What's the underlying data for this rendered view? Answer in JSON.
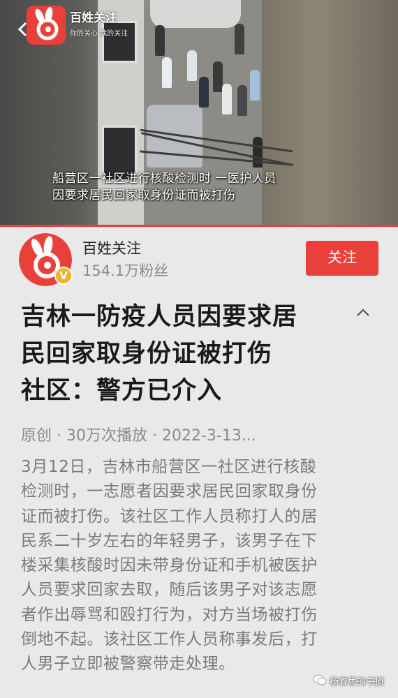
{
  "video": {
    "caption_line1": "船营区一社区进行核酸检测时 一医护人员",
    "caption_line2": "因要求居民回家取身份证而被打伤",
    "source_name": "百姓关注",
    "source_slogan": "你的关心 我的关注",
    "progress": 1.0
  },
  "author": {
    "name": "百姓关注",
    "fans": "154.1万粉丝",
    "verified_badge": "V",
    "follow_label": "关注"
  },
  "article": {
    "title_line1": "吉林一防疫人员因要求居",
    "title_line2": "民回家取身份证被打伤",
    "title_line3": "社区：警方已介入",
    "meta": "原创 · 30万次播放 · 2022-3-13...",
    "body": [
      "3月12日，吉林市船营区一社区进行核酸",
      "检测时，一志愿者因要求居民回家取身份",
      "证而被打伤。该社区工作人员称打人的居",
      "民系二十岁左右的年轻男子，该男子在下",
      "楼采集核酸时因未带身份证和手机被医护",
      "人员要求回家去取，随后该男子对该志愿",
      "者作出辱骂和殴打行为，对方当场被打伤",
      "倒地不起。该社区工作人员称事发后，打",
      "人男子立即被警察带走处理。"
    ]
  },
  "watermark": {
    "text": "杨春思的书摊",
    "icon": "wechat-icon"
  },
  "colors": {
    "accent": "#e8413a",
    "background": "#e9e9e9",
    "verified": "#f0b325"
  },
  "icons": {
    "back": "chevron-left-icon",
    "collapse": "chevron-up-icon",
    "logo": "rabbit-logo-icon"
  }
}
